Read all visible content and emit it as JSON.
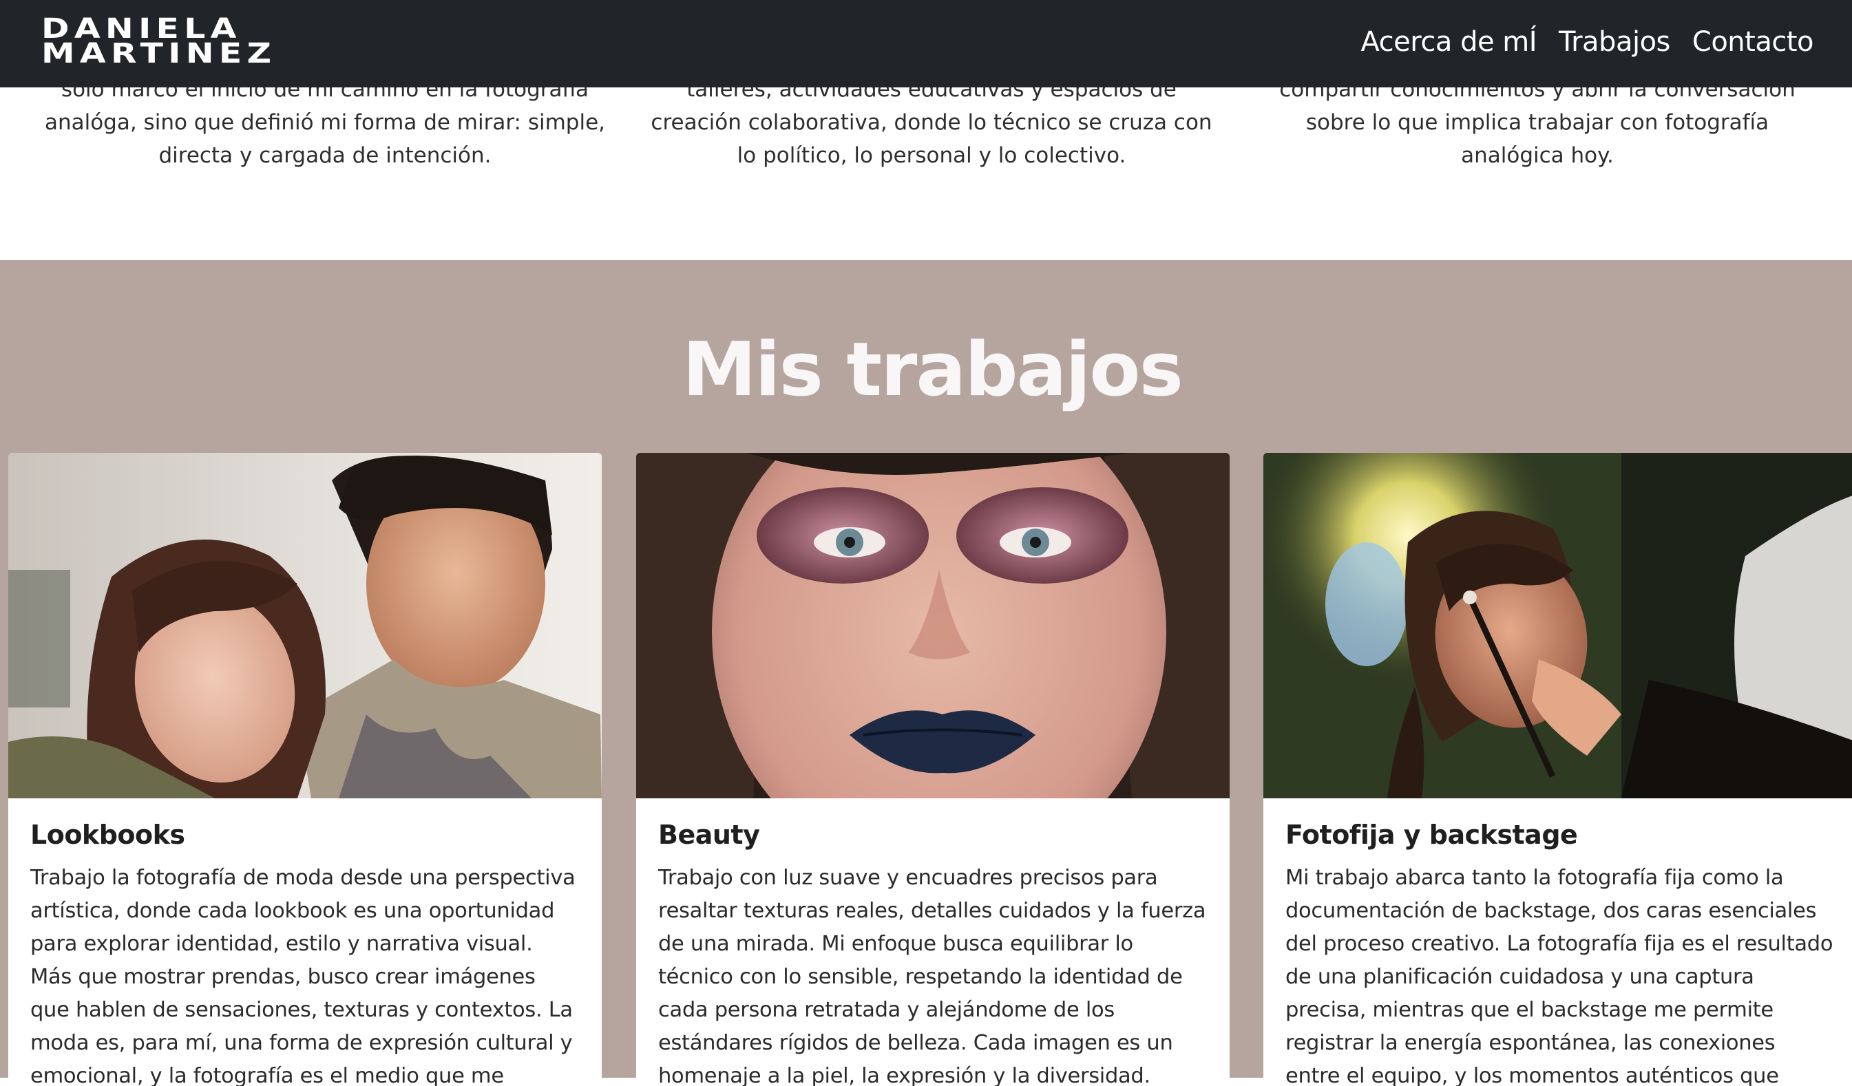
{
  "header": {
    "logo_line1": "DANIELA",
    "logo_line2": "MARTINEZ",
    "nav": {
      "about": "Acerca de mÍ",
      "works": "Trabajos",
      "contact": "Contacto"
    }
  },
  "about": {
    "columns": [
      "solo marcó el inicio de mi camino en la fotografía analóga, sino que definió mi forma de mirar: simple, directa y cargada de intención.",
      "talleres, actividades educativas y espacios de creación colaborativa, donde lo técnico se cruza con lo político, lo personal y lo colectivo.",
      "compartir conocimientos y abrir la conversación sobre lo que implica trabajar con fotografía analógica hoy."
    ]
  },
  "works": {
    "title": "Mis trabajos",
    "cards": [
      {
        "title": "Lookbooks",
        "text": "Trabajo la fotografía de moda desde una perspectiva artística, donde cada lookbook es una oportunidad para explorar identidad, estilo y narrativa visual. Más que mostrar prendas, busco crear imágenes que hablen de sensaciones, texturas y contextos. La moda es, para mí, una forma de expresión cultural y emocional, y la fotografía es el medio que me permite"
      },
      {
        "title": "Beauty",
        "text": "Trabajo con luz suave y encuadres precisos para resaltar texturas reales, detalles cuidados y la fuerza de una mirada. Mi enfoque busca equilibrar lo técnico con lo sensible, respetando la identidad de cada persona retratada y alejándome de los estándares rígidos de belleza. Cada imagen es un homenaje a la piel, la expresión y la diversidad."
      },
      {
        "title": "Fotofija y backstage",
        "text": "Mi trabajo abarca tanto la fotografía fija como la documentación de backstage, dos caras esenciales del proceso creativo. La fotografía fija es el resultado de una planificación cuidadosa y una captura precisa, mientras que el backstage me permite registrar la energía espontánea, las conexiones entre el equipo, y los momentos auténticos que nacen detrás de"
      }
    ]
  },
  "colors": {
    "topbar": "#212529",
    "works_background": "#b5a59e",
    "title_text": "#f8f6f6"
  }
}
